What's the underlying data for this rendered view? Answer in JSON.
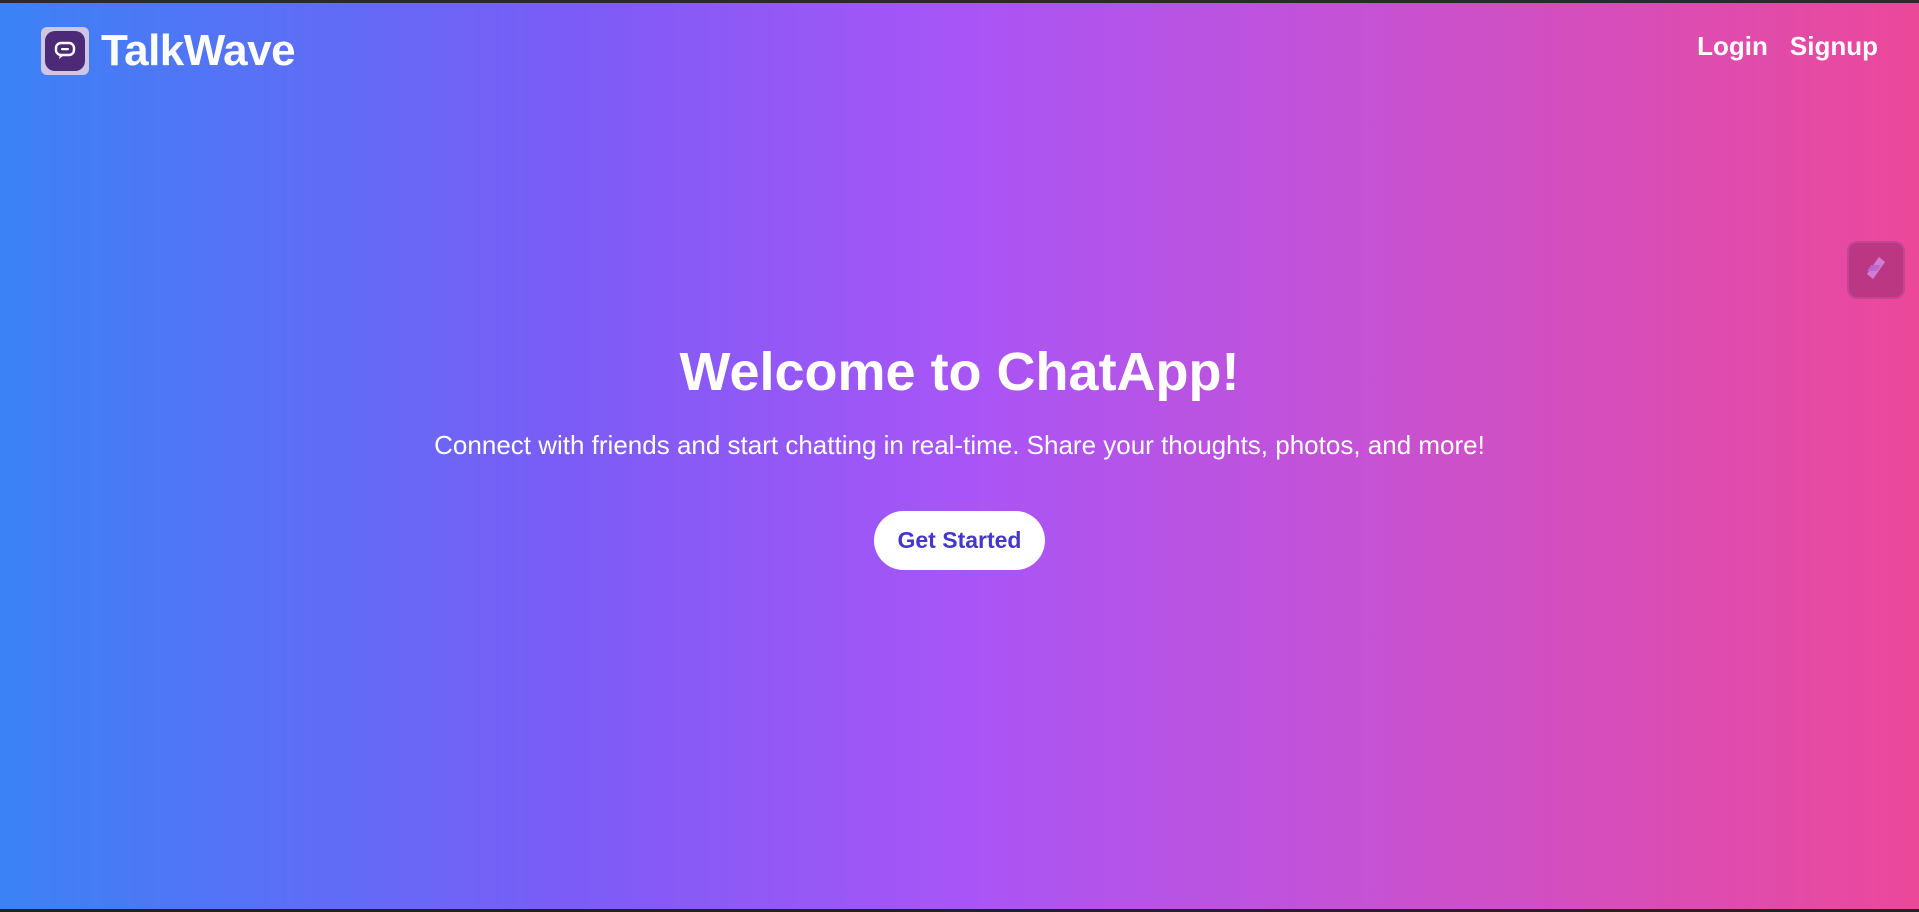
{
  "app": {
    "brand_name": "TalkWave",
    "logo_icon": "chat-bubble-icon"
  },
  "nav": {
    "login_label": "Login",
    "signup_label": "Signup"
  },
  "hero": {
    "title": "Welcome to ChatApp!",
    "subtitle": "Connect with friends and start chatting in real-time. Share your thoughts, photos, and more!",
    "cta_label": "Get Started"
  },
  "side_widget": {
    "icon": "extension-icon"
  },
  "colors": {
    "gradient_start": "#3b82f6",
    "gradient_mid": "#a855f7",
    "gradient_end": "#ec4899",
    "cta_text": "#4338ca",
    "cta_bg": "#ffffff"
  }
}
